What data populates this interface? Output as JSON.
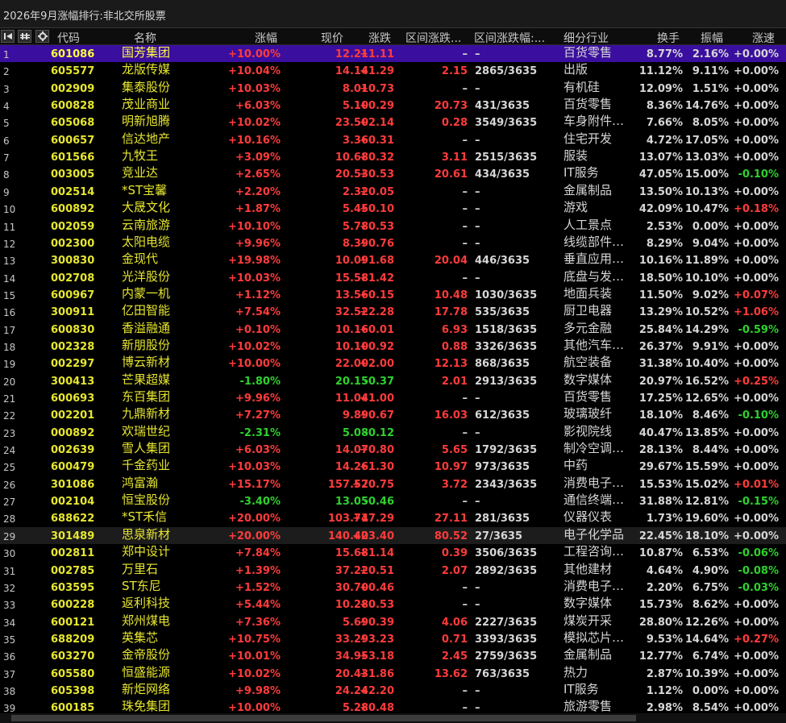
{
  "window": {
    "title": "2026年9月涨幅排行:非北交所股票"
  },
  "columns": [
    "代码",
    "名称",
    "涨幅",
    "现价",
    "涨跌",
    "区间涨跌...",
    "区间涨跌幅:...",
    "细分行业",
    "换手",
    "振幅",
    "涨速"
  ],
  "rows": [
    [
      "1",
      "601086",
      "国芳集团",
      "+10.00%",
      "12.21",
      "+1.11",
      "–",
      "–",
      "百货零售",
      "8.77%",
      "2.16%",
      "+0.00%"
    ],
    [
      "2",
      "605577",
      "龙版传媒",
      "+10.04%",
      "14.14",
      "+1.29",
      "2.15",
      "2865/3635",
      "出版",
      "11.12%",
      "9.11%",
      "+0.00%"
    ],
    [
      "3",
      "002909",
      "集泰股份",
      "+10.03%",
      "8.01",
      "+0.73",
      "–",
      "–",
      "有机硅",
      "12.09%",
      "1.51%",
      "+0.00%"
    ],
    [
      "4",
      "600828",
      "茂业商业",
      "+6.03%",
      "5.10",
      "+0.29",
      "20.73",
      "431/3635",
      "百货零售",
      "8.36%",
      "14.76%",
      "+0.00%"
    ],
    [
      "5",
      "605068",
      "明新旭腾",
      "+10.02%",
      "23.50",
      "+2.14",
      "0.28",
      "3549/3635",
      "车身附件…",
      "7.66%",
      "8.05%",
      "+0.00%"
    ],
    [
      "6",
      "600657",
      "信达地产",
      "+10.16%",
      "3.36",
      "+0.31",
      "–",
      "–",
      "住宅开发",
      "4.72%",
      "17.05%",
      "+0.00%"
    ],
    [
      "7",
      "601566",
      "九牧王",
      "+3.09%",
      "10.68",
      "+0.32",
      "3.11",
      "2515/3635",
      "服装",
      "13.07%",
      "13.03%",
      "+0.00%"
    ],
    [
      "8",
      "003005",
      "竞业达",
      "+2.65%",
      "20.53",
      "+0.53",
      "20.61",
      "434/3635",
      "IT服务",
      "47.05%",
      "15.00%",
      "-0.10%"
    ],
    [
      "9",
      "002514",
      "*ST宝馨",
      "+2.20%",
      "2.32",
      "+0.05",
      "–",
      "–",
      "金属制品",
      "13.50%",
      "10.13%",
      "+0.00%"
    ],
    [
      "10",
      "600892",
      "大晟文化",
      "+1.87%",
      "5.45",
      "+0.10",
      "–",
      "–",
      "游戏",
      "42.09%",
      "10.47%",
      "+0.18%"
    ],
    [
      "11",
      "002059",
      "云南旅游",
      "+10.10%",
      "5.78",
      "+0.53",
      "–",
      "–",
      "人工景点",
      "2.53%",
      "0.00%",
      "+0.00%"
    ],
    [
      "12",
      "002300",
      "太阳电缆",
      "+9.96%",
      "8.39",
      "+0.76",
      "–",
      "–",
      "线缆部件…",
      "8.29%",
      "9.04%",
      "+0.00%"
    ],
    [
      "13",
      "300830",
      "金现代",
      "+19.98%",
      "10.09",
      "+1.68",
      "20.04",
      "446/3635",
      "垂直应用…",
      "10.16%",
      "11.89%",
      "+0.00%"
    ],
    [
      "14",
      "002708",
      "光洋股份",
      "+10.03%",
      "15.58",
      "+1.42",
      "–",
      "–",
      "底盘与发…",
      "18.50%",
      "10.10%",
      "+0.00%"
    ],
    [
      "15",
      "600967",
      "内蒙一机",
      "+1.12%",
      "13.56",
      "+0.15",
      "10.48",
      "1030/3635",
      "地面兵装",
      "11.50%",
      "9.02%",
      "+0.07%"
    ],
    [
      "16",
      "300911",
      "亿田智能",
      "+7.54%",
      "32.52",
      "+2.28",
      "17.78",
      "535/3635",
      "厨卫电器",
      "13.29%",
      "10.52%",
      "+1.06%"
    ],
    [
      "17",
      "600830",
      "香溢融通",
      "+0.10%",
      "10.16",
      "+0.01",
      "6.93",
      "1518/3635",
      "多元金融",
      "25.84%",
      "14.29%",
      "-0.59%"
    ],
    [
      "18",
      "002328",
      "新朋股份",
      "+10.02%",
      "10.10",
      "+0.92",
      "0.88",
      "3326/3635",
      "其他汽车…",
      "26.37%",
      "9.91%",
      "+0.00%"
    ],
    [
      "19",
      "002297",
      "博云新材",
      "+10.00%",
      "22.00",
      "+2.00",
      "12.13",
      "868/3635",
      "航空装备",
      "31.38%",
      "10.40%",
      "+0.00%"
    ],
    [
      "20",
      "300413",
      "芒果超媒",
      "-1.80%",
      "20.15",
      "-0.37",
      "2.01",
      "2913/3635",
      "数字媒体",
      "20.97%",
      "16.52%",
      "+0.25%"
    ],
    [
      "21",
      "600693",
      "东百集团",
      "+9.96%",
      "11.04",
      "+1.00",
      "–",
      "–",
      "百货零售",
      "17.25%",
      "12.65%",
      "+0.00%"
    ],
    [
      "22",
      "002201",
      "九鼎新材",
      "+7.27%",
      "9.89",
      "+0.67",
      "16.03",
      "612/3635",
      "玻璃玻纤",
      "18.10%",
      "8.46%",
      "-0.10%"
    ],
    [
      "23",
      "000892",
      "欢瑞世纪",
      "-2.31%",
      "5.08",
      "-0.12",
      "–",
      "–",
      "影视院线",
      "40.47%",
      "13.85%",
      "+0.00%"
    ],
    [
      "24",
      "002639",
      "雪人集团",
      "+6.03%",
      "14.07",
      "+0.80",
      "5.65",
      "1792/3635",
      "制冷空调…",
      "28.13%",
      "8.44%",
      "+0.00%"
    ],
    [
      "25",
      "600479",
      "千金药业",
      "+10.03%",
      "14.26",
      "+1.30",
      "10.97",
      "973/3635",
      "中药",
      "29.67%",
      "15.59%",
      "+0.00%"
    ],
    [
      "26",
      "301086",
      "鸿富瀚",
      "+15.17%",
      "157.57",
      "+20.75",
      "3.72",
      "2343/3635",
      "消费电子…",
      "15.53%",
      "15.02%",
      "+0.01%"
    ],
    [
      "27",
      "002104",
      "恒宝股份",
      "-3.40%",
      "13.05",
      "-0.46",
      "–",
      "–",
      "通信终端…",
      "31.88%",
      "12.81%",
      "-0.15%"
    ],
    [
      "28",
      "688622",
      "*ST禾信",
      "+20.00%",
      "103.74",
      "+17.29",
      "27.11",
      "281/3635",
      "仪器仪表",
      "1.73%",
      "19.60%",
      "+0.00%"
    ],
    [
      "29",
      "301489",
      "思泉新材",
      "+20.00%",
      "140.40",
      "+23.40",
      "80.52",
      "27/3635",
      "电子化学品",
      "22.45%",
      "18.10%",
      "+0.00%"
    ],
    [
      "30",
      "002811",
      "郑中设计",
      "+7.84%",
      "15.68",
      "+1.14",
      "0.39",
      "3506/3635",
      "工程咨询…",
      "10.87%",
      "6.53%",
      "-0.06%"
    ],
    [
      "31",
      "002785",
      "万里石",
      "+1.39%",
      "37.22",
      "+0.51",
      "2.07",
      "2892/3635",
      "其他建材",
      "4.64%",
      "4.90%",
      "-0.08%"
    ],
    [
      "32",
      "603595",
      "ST东尼",
      "+1.52%",
      "30.70",
      "+0.46",
      "–",
      "–",
      "消费电子…",
      "2.20%",
      "6.75%",
      "-0.03%"
    ],
    [
      "33",
      "600228",
      "返利科技",
      "+5.44%",
      "10.28",
      "+0.53",
      "–",
      "–",
      "数字媒体",
      "15.73%",
      "8.62%",
      "+0.00%"
    ],
    [
      "34",
      "600121",
      "郑州煤电",
      "+7.36%",
      "5.69",
      "+0.39",
      "4.06",
      "2227/3635",
      "煤炭开采",
      "28.80%",
      "12.26%",
      "+0.00%"
    ],
    [
      "35",
      "688209",
      "英集芯",
      "+10.75%",
      "33.29",
      "+3.23",
      "0.71",
      "3393/3635",
      "模拟芯片…",
      "9.53%",
      "14.64%",
      "+0.27%"
    ],
    [
      "36",
      "603270",
      "金帝股份",
      "+10.01%",
      "34.95",
      "+3.18",
      "2.45",
      "2759/3635",
      "金属制品",
      "12.77%",
      "6.74%",
      "+0.00%"
    ],
    [
      "37",
      "605580",
      "恒盛能源",
      "+10.02%",
      "20.43",
      "+1.86",
      "13.62",
      "763/3635",
      "热力",
      "2.87%",
      "10.39%",
      "+0.00%"
    ],
    [
      "38",
      "605398",
      "新炬网络",
      "+9.98%",
      "24.24",
      "+2.20",
      "–",
      "–",
      "IT服务",
      "1.12%",
      "0.00%",
      "+0.00%"
    ],
    [
      "39",
      "600185",
      "珠免集团",
      "+10.00%",
      "5.28",
      "+0.48",
      "–",
      "–",
      "旅游零售",
      "2.98%",
      "8.54%",
      "+0.00%"
    ]
  ],
  "selected_row": 0,
  "highlight_row": 28,
  "colors": {
    "up": "#ff3b3b",
    "down": "#2ed12e",
    "code": "#e6e630",
    "selection": "#3a0e9e"
  }
}
